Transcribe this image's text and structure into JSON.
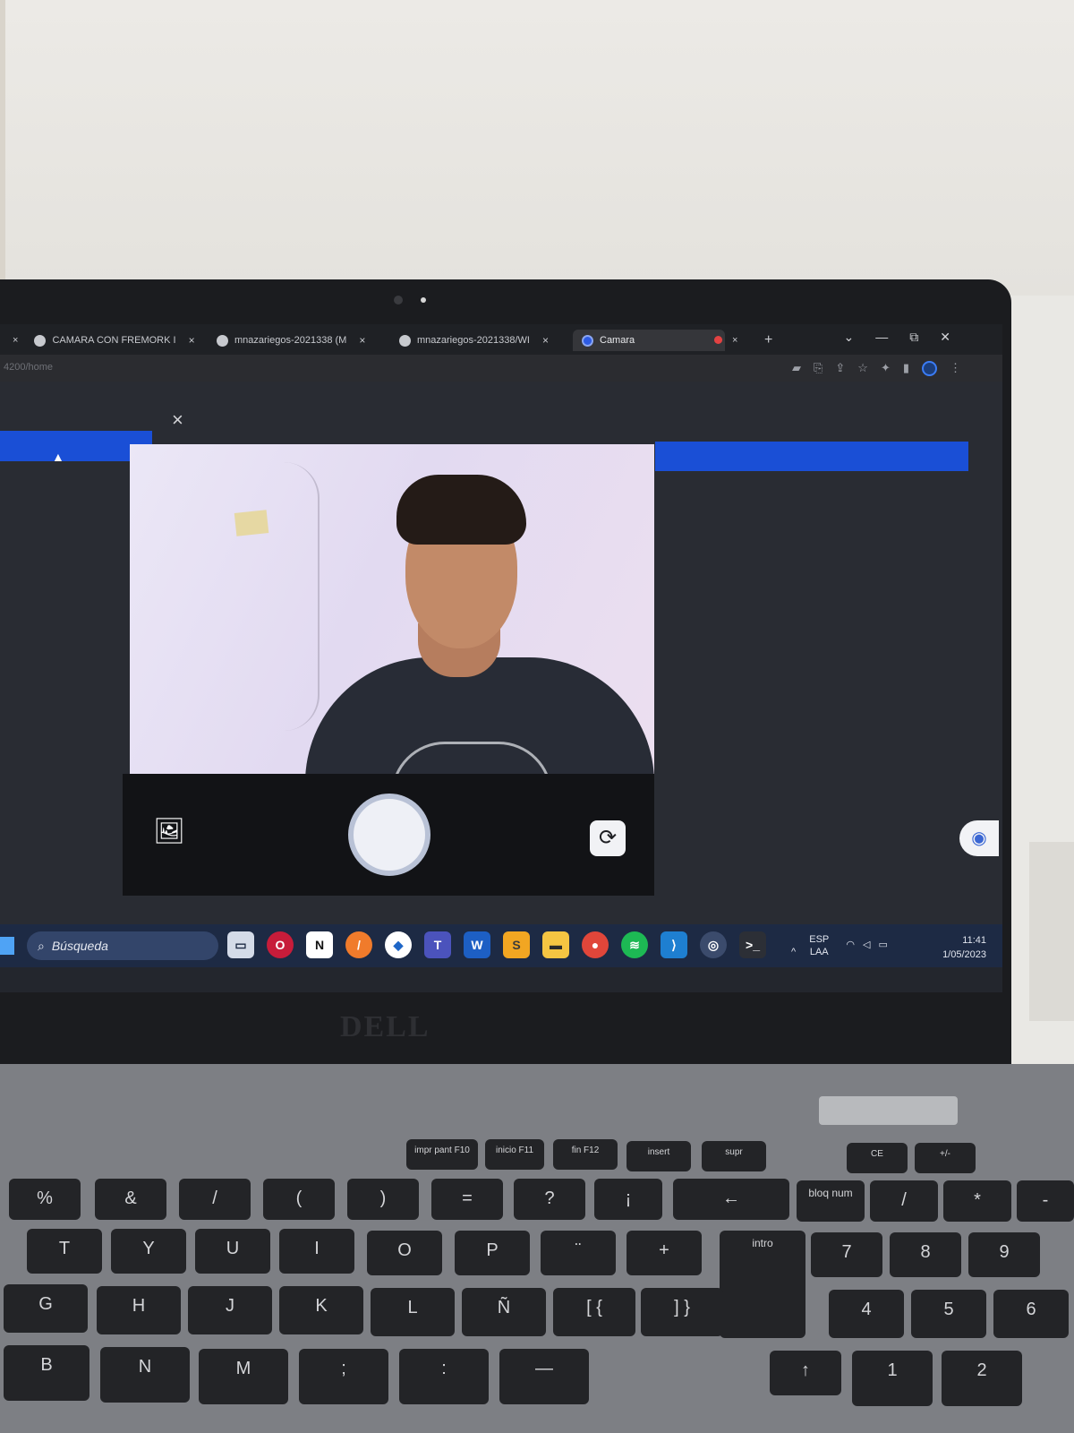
{
  "browser": {
    "tabs": [
      {
        "title": "CAMARA CON FREMORK I",
        "close": "×"
      },
      {
        "title": "mnazariegos-2021338 (M",
        "close": "×"
      },
      {
        "title": "mnazariegos-2021338/WI",
        "close": "×"
      },
      {
        "title": "Camara",
        "close": "×"
      }
    ],
    "new_tab": "+",
    "url": "4200/home"
  },
  "camera_modal": {
    "close_label": "×"
  },
  "taskbar": {
    "search_placeholder": "Búsqueda",
    "language_top": "ESP",
    "language_bottom": "LAA",
    "time": "11:41",
    "date": "1/05/2023",
    "apps": [
      "task-view",
      "opera",
      "notion",
      "sublime",
      "drop",
      "teams",
      "word",
      "sublime-text",
      "file-explorer",
      "chrome",
      "spotify",
      "vscode",
      "chrome-dev",
      "terminal"
    ]
  },
  "laptop": {
    "brand": "DELL"
  },
  "keyboard": {
    "fn_row": [
      "impr pant F10",
      "inicio F11",
      "fin F12",
      "insert",
      "supr",
      "CE",
      "+/-"
    ],
    "num_row": [
      "%",
      "&",
      "/",
      "(",
      ")",
      "=",
      "?",
      "¡",
      "←",
      "bloq num",
      "/",
      "*",
      "-"
    ],
    "row_top": [
      "T",
      "Y",
      "U",
      "I",
      "O",
      "P",
      "¨",
      "+",
      "intro",
      "7",
      "8",
      "9"
    ],
    "row_mid": [
      "G",
      "H",
      "J",
      "K",
      "L",
      "Ñ",
      "[ {",
      "] }",
      "4",
      "5",
      "6"
    ],
    "row_bot": [
      "B",
      "N",
      "M",
      ";",
      ":",
      "—",
      "↑",
      "1",
      "2"
    ]
  },
  "colors": {
    "accent_bar": "#1a4fd6",
    "taskbar": "#1d2a44",
    "page_bg": "#292c33"
  }
}
